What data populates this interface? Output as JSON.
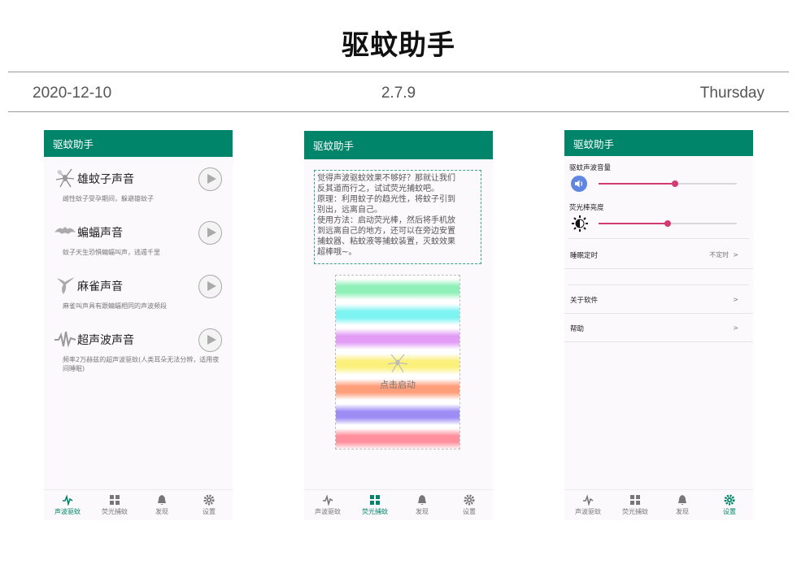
{
  "header": {
    "title": "驱蚊助手",
    "date": "2020-12-10",
    "version": "2.7.9",
    "weekday": "Thursday"
  },
  "colors": {
    "primary": "#00856b",
    "slider": "#d33a71"
  },
  "tabs": [
    {
      "label": "声波驱蚊",
      "icon": "pulse-icon"
    },
    {
      "label": "荧光捕蚊",
      "icon": "grid-icon"
    },
    {
      "label": "发现",
      "icon": "bell-icon"
    },
    {
      "label": "设置",
      "icon": "gear-icon"
    }
  ],
  "screen1": {
    "app_title": "驱蚊助手",
    "items": [
      {
        "title": "雄蚊子声音",
        "desc": "雌性蚊子受孕期间，躲避雄蚊子",
        "icon": "mosquito-icon"
      },
      {
        "title": "蝙蝠声音",
        "desc": "蚊子天生恐惧蝙蝠叫声，逃遁千里",
        "icon": "bat-icon"
      },
      {
        "title": "麻雀声音",
        "desc": "麻雀叫声具有跟蝙蝠相同的声波频段",
        "icon": "sparrow-icon"
      },
      {
        "title": "超声波声音",
        "desc": "频率2万赫兹的超声波驱蚊(人类耳朵无法分辨，适用夜间睡眠)",
        "icon": "waveform-icon"
      }
    ],
    "active_tab": 0
  },
  "screen2": {
    "app_title": "驱蚊助手",
    "tip_lines": [
      "觉得声波驱蚊效果不够好？那就让我们",
      "反其道而行之，试试荧光捕蚊吧。",
      "原理：利用蚊子的趋光性，将蚊子引到",
      "别出，远离自己。",
      "使用方法：启动荧光棒，然后将手机放",
      "到远离自己的地方，还可以在旁边安置",
      "捕蚊器、粘蚊液等捕蚊装置，灭蚊效果",
      "超棒哦~。"
    ],
    "start_label": "点击启动",
    "stripe_colors": [
      "#8ff0b8",
      "#7df4f2",
      "#e29cf6",
      "#fbf07c",
      "#ff9e7a",
      "#9d8cf4",
      "#ff8f9c"
    ],
    "active_tab": 1
  },
  "screen3": {
    "app_title": "驱蚊助手",
    "volume_label": "驱蚊声波音量",
    "volume_level": 0.55,
    "brightness_label": "荧光棒亮度",
    "brightness_level": 0.5,
    "sleep_timer_label": "睡眠定时",
    "sleep_timer_value": "不定时",
    "about_label": "关于软件",
    "help_label": "帮助",
    "chevron": ">",
    "active_tab": 3
  }
}
